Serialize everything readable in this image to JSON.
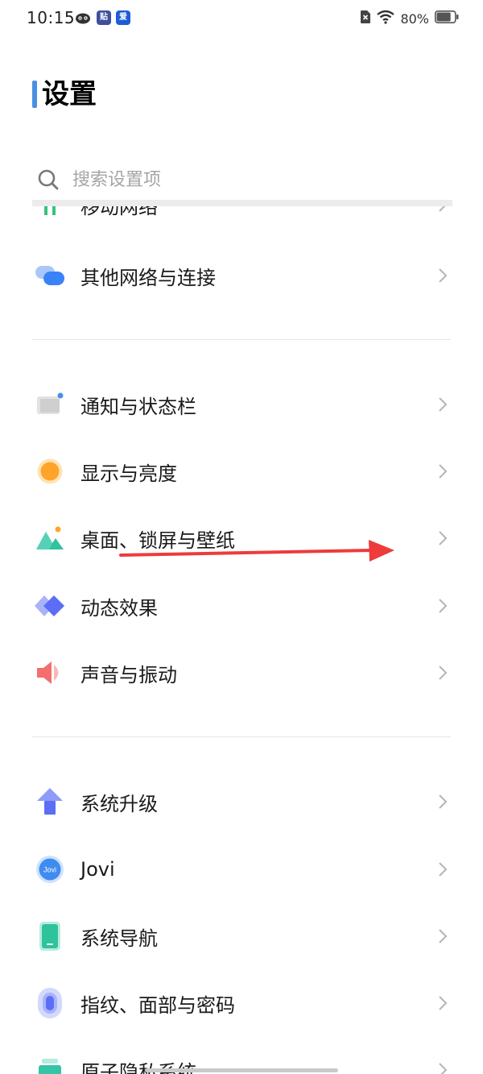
{
  "status_bar": {
    "time": "10:15",
    "notif_apps": [
      {
        "icon": "cat-face-icon",
        "label": ""
      },
      {
        "icon": "tieba-app-icon",
        "label": "贴"
      },
      {
        "icon": "blue-app-icon",
        "label": "爱"
      }
    ],
    "battery_percent": "80%",
    "battery_level": 0.8
  },
  "page": {
    "title": "设置"
  },
  "search": {
    "placeholder": "搜索设置项"
  },
  "partial_top_item": {
    "label": "移动网络",
    "icon": "signal-bars-icon"
  },
  "groups": [
    {
      "items": [
        {
          "label": "其他网络与连接",
          "icon": "network-connection-icon",
          "color": "#3a82f7"
        }
      ]
    },
    {
      "items": [
        {
          "label": "通知与状态栏",
          "icon": "notification-icon",
          "color": "#cfcfcf"
        },
        {
          "label": "显示与亮度",
          "icon": "brightness-icon",
          "color": "#ffa42b"
        },
        {
          "label": "桌面、锁屏与壁纸",
          "icon": "wallpaper-icon",
          "color": "#2fc3a2"
        },
        {
          "label": "动态效果",
          "icon": "motion-effect-icon",
          "color": "#5b6ef5"
        },
        {
          "label": "声音与振动",
          "icon": "speaker-icon",
          "color": "#f36f6f"
        }
      ]
    },
    {
      "items": [
        {
          "label": "系统升级",
          "icon": "upgrade-arrow-icon",
          "color": "#6f7ff5"
        },
        {
          "label": "Jovi",
          "icon": "jovi-icon",
          "color": "#3f8cf0"
        },
        {
          "label": "系统导航",
          "icon": "phone-navigation-icon",
          "color": "#2fc39b"
        },
        {
          "label": "指纹、面部与密码",
          "icon": "fingerprint-icon",
          "color": "#5b6ef5"
        },
        {
          "label": "原子隐私系统",
          "icon": "privacy-icon",
          "color": "#35c4a6"
        }
      ]
    }
  ],
  "colors": {
    "accent": "#4a90e2",
    "annotation_arrow": "#ee3b3b"
  }
}
